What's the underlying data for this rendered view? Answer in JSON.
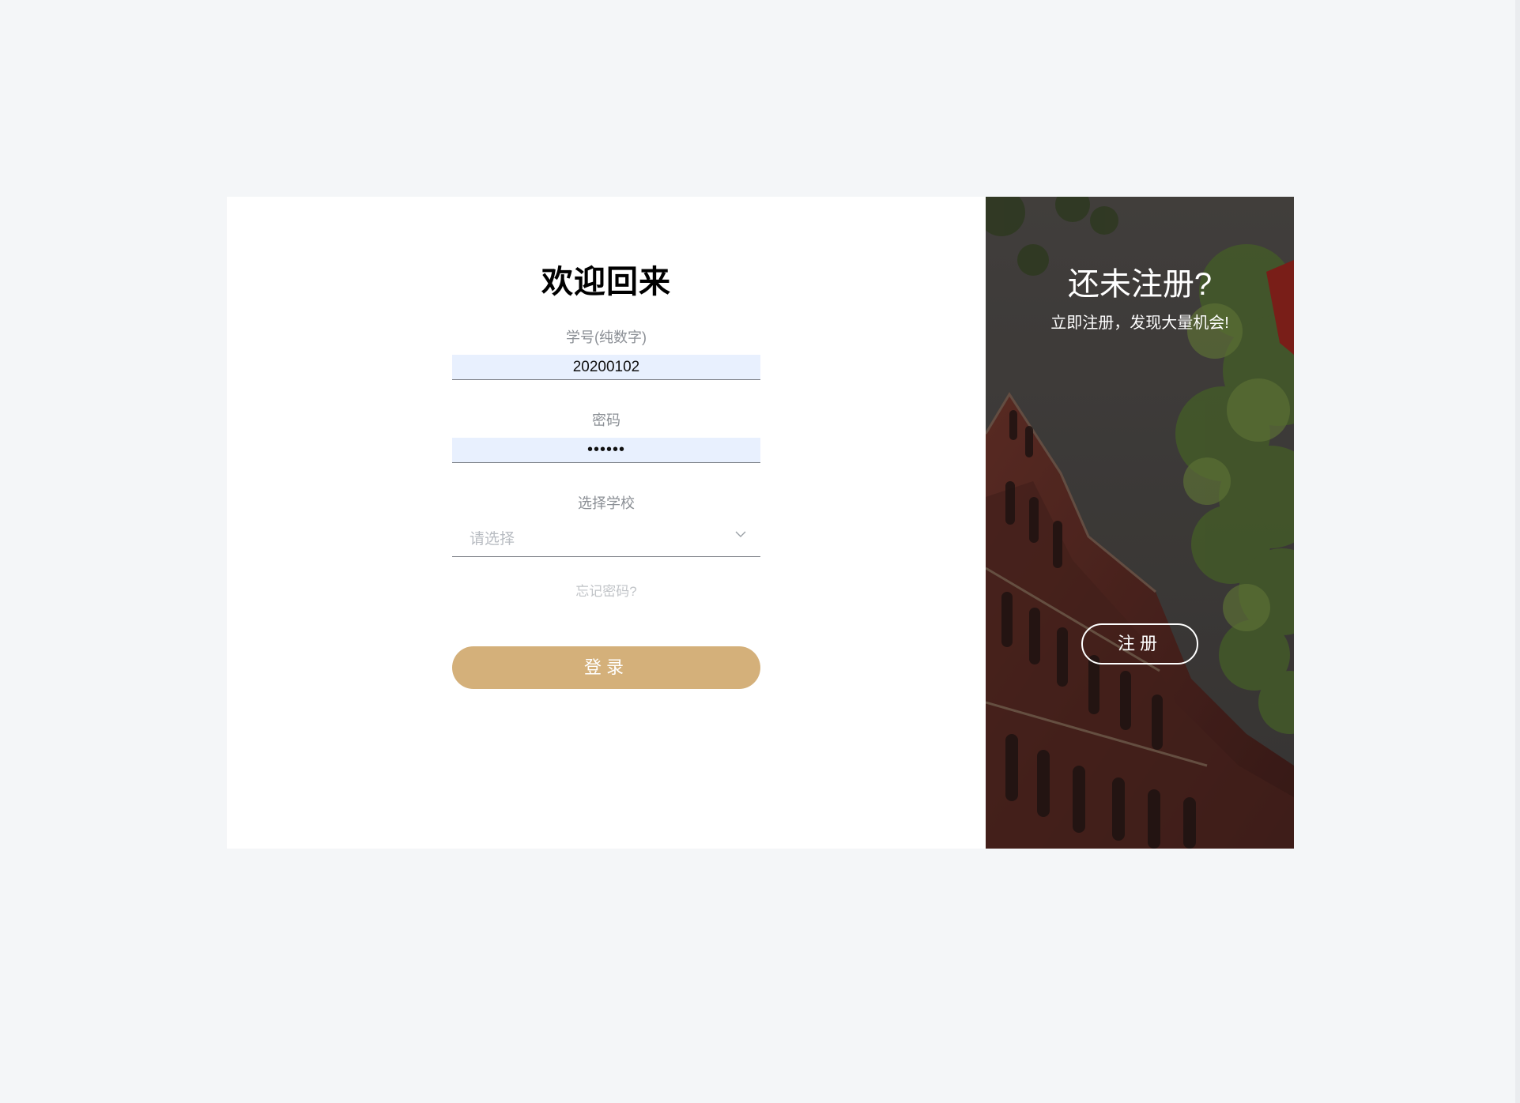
{
  "login": {
    "title": "欢迎回来",
    "student_id": {
      "label": "学号(纯数字)",
      "value": "20200102"
    },
    "password": {
      "label": "密码",
      "value": "••••••"
    },
    "school": {
      "label": "选择学校",
      "placeholder": "请选择"
    },
    "forgot_label": "忘记密码?",
    "submit_label": "登录"
  },
  "register": {
    "title": "还未注册?",
    "subtitle": "立即注册，发现大量机会!",
    "button_label": "注册"
  },
  "colors": {
    "page_background": "#f4f6f8",
    "accent": "#d4b07a",
    "input_autofill": "#e8f0fe"
  },
  "icons": {
    "select_arrow": "chevron-down-icon"
  }
}
